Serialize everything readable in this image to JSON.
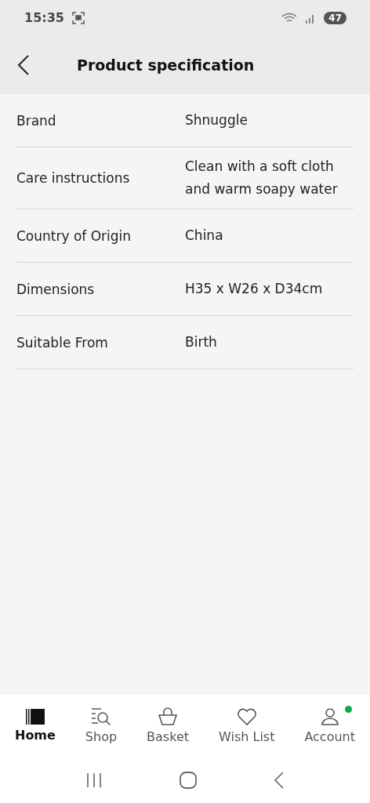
{
  "status_bar": {
    "time": "15:35",
    "battery": "47"
  },
  "header": {
    "title": "Product specification"
  },
  "specs": [
    {
      "label": "Brand",
      "value": "Shnuggle"
    },
    {
      "label": "Care instructions",
      "value": "Clean with a soft cloth and warm soapy water"
    },
    {
      "label": "Country of Origin",
      "value": "China"
    },
    {
      "label": "Dimensions",
      "value": "H35 x W26 x D34cm"
    },
    {
      "label": "Suitable From",
      "value": "Birth"
    }
  ],
  "bottom_nav": [
    {
      "kind": "home",
      "label": "Home",
      "selected": true,
      "dot": false
    },
    {
      "kind": "shop",
      "label": "Shop",
      "selected": false,
      "dot": false
    },
    {
      "kind": "basket",
      "label": "Basket",
      "selected": false,
      "dot": false
    },
    {
      "kind": "wishlist",
      "label": "Wish List",
      "selected": false,
      "dot": false
    },
    {
      "kind": "account",
      "label": "Account",
      "selected": false,
      "dot": true
    }
  ]
}
